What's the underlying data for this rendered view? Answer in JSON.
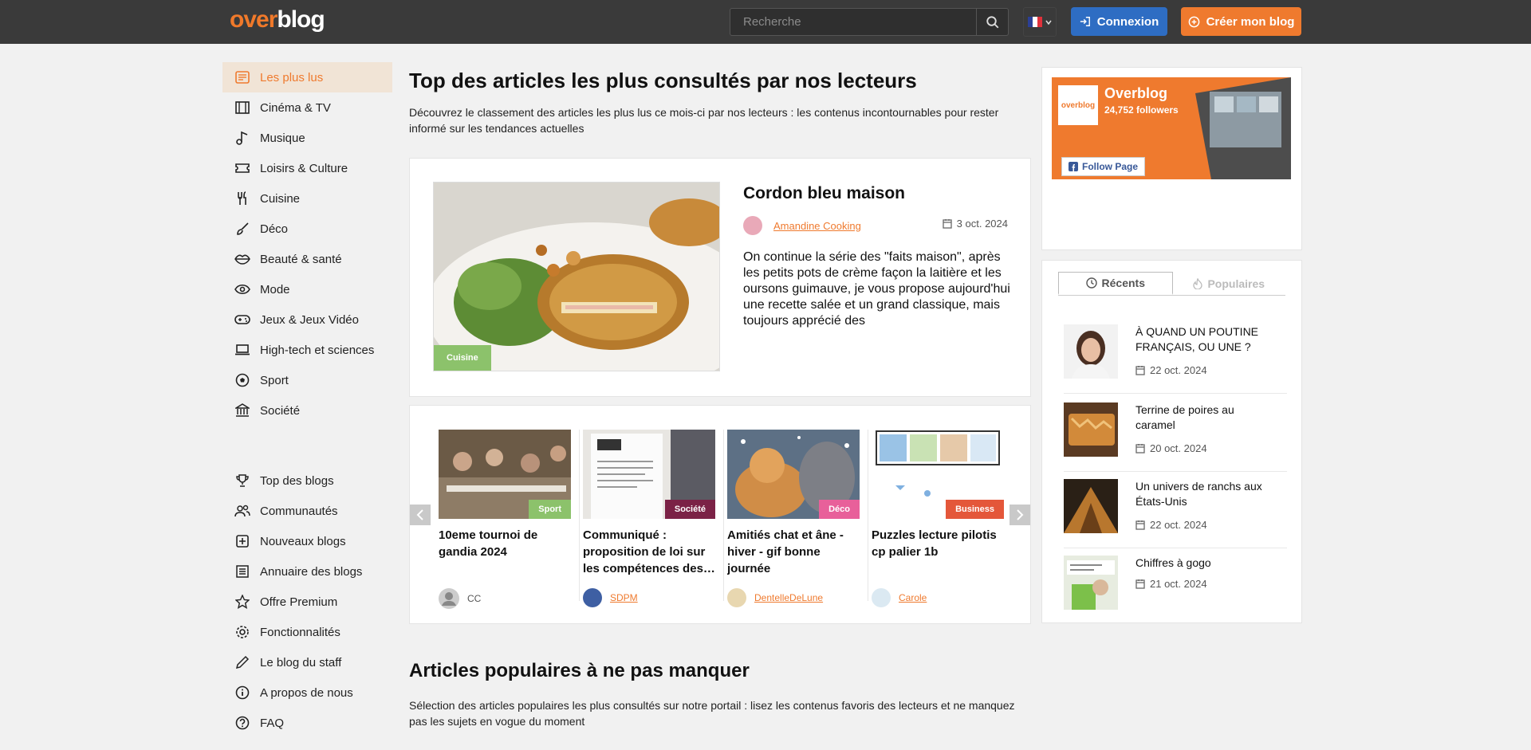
{
  "header": {
    "logo_over": "over",
    "logo_blog": "blog",
    "search_placeholder": "Recherche",
    "login_label": "Connexion",
    "create_label": "Créer mon blog"
  },
  "sidebar": {
    "items": [
      {
        "label": "Les plus lus",
        "icon": "newspaper-icon"
      },
      {
        "label": "Cinéma & TV",
        "icon": "film-icon"
      },
      {
        "label": "Musique",
        "icon": "music-icon"
      },
      {
        "label": "Loisirs & Culture",
        "icon": "ticket-icon"
      },
      {
        "label": "Cuisine",
        "icon": "utensils-icon"
      },
      {
        "label": "Déco",
        "icon": "brush-icon"
      },
      {
        "label": "Beauté & santé",
        "icon": "lips-icon"
      },
      {
        "label": "Mode",
        "icon": "eye-icon"
      },
      {
        "label": "Jeux & Jeux Vidéo",
        "icon": "gamepad-icon"
      },
      {
        "label": "High-tech et sciences",
        "icon": "laptop-icon"
      },
      {
        "label": "Sport",
        "icon": "soccer-ball-icon"
      },
      {
        "label": "Société",
        "icon": "bank-icon"
      }
    ],
    "items2": [
      {
        "label": "Top des blogs",
        "icon": "trophy-icon"
      },
      {
        "label": "Communautés",
        "icon": "users-icon"
      },
      {
        "label": "Nouveaux blogs",
        "icon": "plus-square-icon"
      },
      {
        "label": "Annuaire des blogs",
        "icon": "list-icon"
      },
      {
        "label": "Offre Premium",
        "icon": "star-icon"
      },
      {
        "label": "Fonctionnalités",
        "icon": "gear-icon"
      },
      {
        "label": "Le blog du staff",
        "icon": "pen-icon"
      },
      {
        "label": "A propos de nous",
        "icon": "info-icon"
      },
      {
        "label": "FAQ",
        "icon": "question-icon"
      }
    ]
  },
  "main": {
    "title": "Top des articles les plus consultés par nos lecteurs",
    "lead": "Découvrez le classement des articles les plus lus ce mois-ci par nos lecteurs : les contenus incontournables pour rester informé sur les tendances actuelles",
    "featured": {
      "tag": "Cuisine",
      "title": "Cordon bleu maison",
      "author": "Amandine Cooking",
      "date": "3 oct. 2024",
      "excerpt": "On continue la série des \"faits maison\", après les petits pots de crème façon la laitière et les oursons guimauve, je vous propose aujourd'hui une recette salée et un grand classique, mais toujours apprécié des"
    },
    "carousel": [
      {
        "tag": "Sport",
        "tag_color": "#8cc26b",
        "title": "10eme tournoi de gandia 2024",
        "author": "CC",
        "author_link": false
      },
      {
        "tag": "Société",
        "tag_color": "#7b2246",
        "title": "Communiqué : proposition de loi sur les compétences des…",
        "author": "SDPM",
        "author_link": true
      },
      {
        "tag": "Déco",
        "tag_color": "#e8609a",
        "title": "Amitiés chat et âne - hiver - gif bonne journée",
        "author": "DentelleDeLune",
        "author_link": true
      },
      {
        "tag": "Business",
        "tag_color": "#e4573a",
        "title": "Puzzles lecture pilotis cp palier 1b",
        "author": "Carole",
        "author_link": true
      }
    ],
    "section2_title": "Articles populaires à ne pas manquer",
    "section2_lead": "Sélection des articles populaires les plus consultés sur notre portail : lisez les contenus favoris des lecteurs et ne manquez pas les sujets en vogue du moment"
  },
  "facebook": {
    "name": "Overblog",
    "followers": "24,752 followers",
    "follow_label": "Follow Page",
    "logo_text": "overblog"
  },
  "recent": {
    "tab_recent": "Récents",
    "tab_popular": "Populaires",
    "items": [
      {
        "title": "À QUAND UN POUTINE FRANÇAIS, OU UNE ?",
        "date": "22 oct. 2024"
      },
      {
        "title": "Terrine de poires au caramel",
        "date": "20 oct. 2024"
      },
      {
        "title": "Un univers de ranchs aux États-Unis",
        "date": "22 oct. 2024"
      },
      {
        "title": "Chiffres à gogo",
        "date": "21 oct. 2024"
      }
    ]
  },
  "colors": {
    "accent": "#ef7a2e",
    "header_bg": "#3a3a3a",
    "login_blue": "#2e6dc3"
  }
}
